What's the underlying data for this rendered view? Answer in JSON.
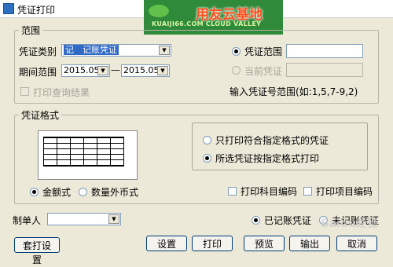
{
  "window": {
    "title": "凭证打印"
  },
  "logo": {
    "main": "用友云基地",
    "sub": "KUAIJI66.COM CLOUD VALLEY"
  },
  "range": {
    "title": "范围",
    "voucher_type_label": "凭证类别",
    "voucher_type_value": "记　记账凭证",
    "period_label": "期间范围",
    "period_from": "2015.05",
    "period_to": "2015.05",
    "period_dash": "—",
    "print_query_results": "打印查询结果",
    "voucher_range_option": "凭证范围",
    "current_voucher_option": "当前凭证",
    "input_hint": "输入凭证号范围(如:1,5,7-9,2)"
  },
  "format": {
    "title": "凭证格式",
    "amount_style": "金额式",
    "quantity_foreign_style": "数量外币式",
    "only_specified_format": "只打印符合指定格式的凭证",
    "all_by_specified_format": "所选凭证按指定格式打印",
    "print_account_code": "打印科目编码",
    "print_item_code": "打印项目编码"
  },
  "maker": {
    "label": "制单人",
    "value": ""
  },
  "status": {
    "posted": "已记账凭证",
    "unposted": "未记账凭证"
  },
  "buttons": {
    "package_setup": "套打设置",
    "settings": "设置",
    "print": "打印",
    "preview": "预览",
    "output": "输出",
    "cancel": "取消"
  },
  "watermark": "Baidu经验"
}
